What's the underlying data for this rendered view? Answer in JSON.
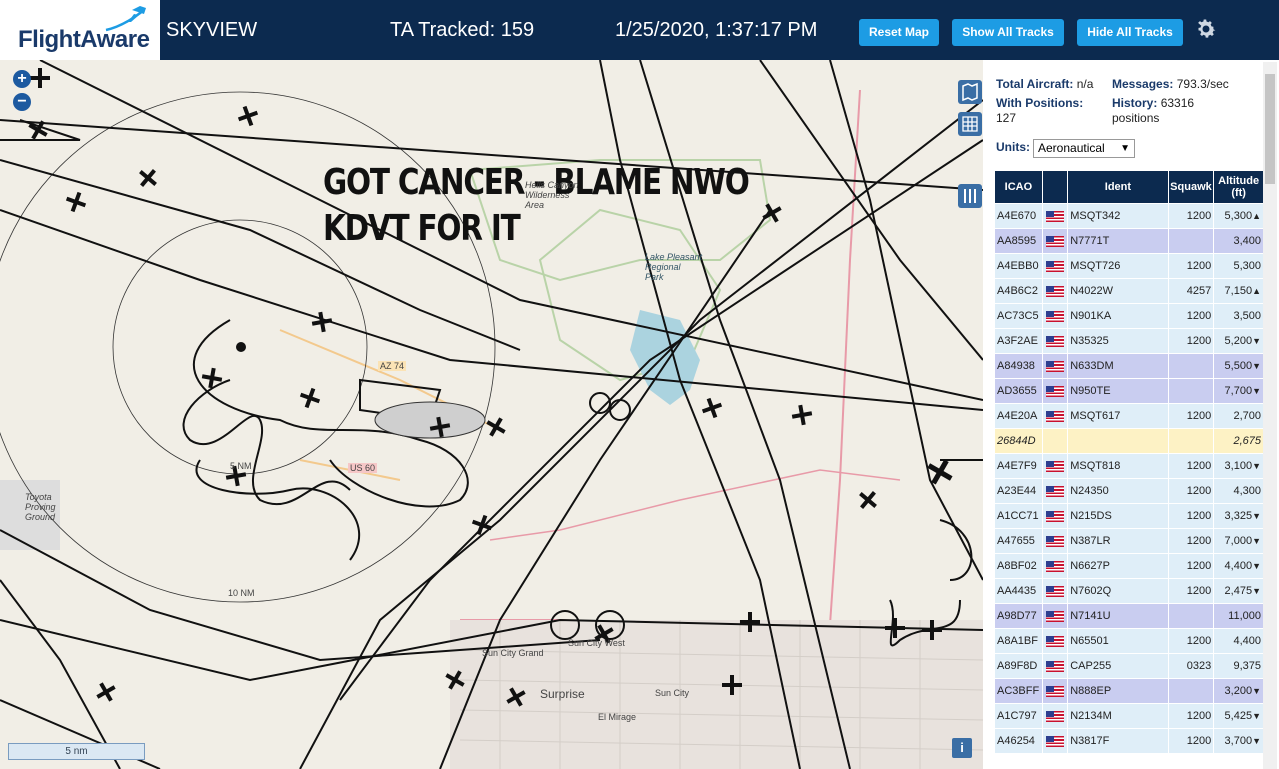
{
  "header": {
    "logo_text": "FlightAware",
    "app_title": "SKYVIEW",
    "ta_tracked": "TA Tracked: 159",
    "datetime": "1/25/2020, 1:37:17 PM",
    "reset_map_label": "Reset Map",
    "show_all_label": "Show All Tracks",
    "hide_all_label": "Hide All Tracks"
  },
  "map": {
    "overlay_line1": "GOT CANCER - BLAME NWO",
    "overlay_line2": "KDVT FOR IT",
    "zoom_in": "+",
    "zoom_out": "−",
    "scale_label": "5 nm",
    "info_label": "i",
    "labels": {
      "hells_canyon": "Hells Canyon\nWilderness\nArea",
      "lake_pleasant": "Lake Pleasant\nRegional\nPark",
      "az74": "AZ 74",
      "us60": "US 60",
      "ring_5": "5 NM",
      "ring_10": "10 NM",
      "sun_city_grand": "Sun City Grand",
      "sun_city_west": "Sun City West",
      "surprise": "Surprise",
      "sun_city": "Sun City",
      "el_mirage": "El Mirage",
      "toyota": "Toyota\nProving\nGround"
    }
  },
  "sidebar": {
    "total_aircraft_label": "Total Aircraft:",
    "total_aircraft_value": "n/a",
    "messages_label": "Messages:",
    "messages_value": "793.3/sec",
    "with_positions_label": "With Positions:",
    "with_positions_value": "127",
    "history_label": "History:",
    "history_value": "63316",
    "history_unit": "positions",
    "units_label": "Units:",
    "units_value": "Aeronautical",
    "columns": {
      "icao": "ICAO",
      "ident": "Ident",
      "squawk": "Squawk",
      "altitude": "Altitude",
      "altitude_unit": "(ft)"
    },
    "rows": [
      {
        "icao": "A4E670",
        "ident": "MSQT342",
        "squawk": "1200",
        "alt": "5,300",
        "trend": "▲",
        "style": "r0",
        "flag": true
      },
      {
        "icao": "AA8595",
        "ident": "N7771T",
        "squawk": "",
        "alt": "3,400",
        "trend": "",
        "style": "r1",
        "flag": true
      },
      {
        "icao": "A4EBB0",
        "ident": "MSQT726",
        "squawk": "1200",
        "alt": "5,300",
        "trend": "",
        "style": "r0",
        "flag": true
      },
      {
        "icao": "A4B6C2",
        "ident": "N4022W",
        "squawk": "4257",
        "alt": "7,150",
        "trend": "▲",
        "style": "r0",
        "flag": true
      },
      {
        "icao": "AC73C5",
        "ident": "N901KA",
        "squawk": "1200",
        "alt": "3,500",
        "trend": "",
        "style": "r0",
        "flag": true
      },
      {
        "icao": "A3F2AE",
        "ident": "N35325",
        "squawk": "1200",
        "alt": "5,200",
        "trend": "▼",
        "style": "r0",
        "flag": true
      },
      {
        "icao": "A84938",
        "ident": "N633DM",
        "squawk": "",
        "alt": "5,500",
        "trend": "▼",
        "style": "r1",
        "flag": true
      },
      {
        "icao": "AD3655",
        "ident": "N950TE",
        "squawk": "",
        "alt": "7,700",
        "trend": "▼",
        "style": "r1",
        "flag": true
      },
      {
        "icao": "A4E20A",
        "ident": "MSQT617",
        "squawk": "1200",
        "alt": "2,700",
        "trend": "",
        "style": "r0",
        "flag": true
      },
      {
        "icao": "26844D",
        "ident": "",
        "squawk": "",
        "alt": "2,675",
        "trend": "",
        "style": "r2",
        "flag": false
      },
      {
        "icao": "A4E7F9",
        "ident": "MSQT818",
        "squawk": "1200",
        "alt": "3,100",
        "trend": "▼",
        "style": "r0",
        "flag": true
      },
      {
        "icao": "A23E44",
        "ident": "N24350",
        "squawk": "1200",
        "alt": "4,300",
        "trend": "",
        "style": "r0",
        "flag": true
      },
      {
        "icao": "A1CC71",
        "ident": "N215DS",
        "squawk": "1200",
        "alt": "3,325",
        "trend": "▼",
        "style": "r0",
        "flag": true
      },
      {
        "icao": "A47655",
        "ident": "N387LR",
        "squawk": "1200",
        "alt": "7,000",
        "trend": "▼",
        "style": "r0",
        "flag": true
      },
      {
        "icao": "A8BF02",
        "ident": "N6627P",
        "squawk": "1200",
        "alt": "4,400",
        "trend": "▼",
        "style": "r0",
        "flag": true
      },
      {
        "icao": "AA4435",
        "ident": "N7602Q",
        "squawk": "1200",
        "alt": "2,475",
        "trend": "▼",
        "style": "r0",
        "flag": true
      },
      {
        "icao": "A98D77",
        "ident": "N7141U",
        "squawk": "",
        "alt": "11,000",
        "trend": "",
        "style": "r1",
        "flag": true
      },
      {
        "icao": "A8A1BF",
        "ident": "N65501",
        "squawk": "1200",
        "alt": "4,400",
        "trend": "",
        "style": "r0",
        "flag": true
      },
      {
        "icao": "A89F8D",
        "ident": "CAP255",
        "squawk": "0323",
        "alt": "9,375",
        "trend": "",
        "style": "r0",
        "flag": true
      },
      {
        "icao": "AC3BFF",
        "ident": "N888EP",
        "squawk": "",
        "alt": "3,200",
        "trend": "▼",
        "style": "r1",
        "flag": true
      },
      {
        "icao": "A1C797",
        "ident": "N2134M",
        "squawk": "1200",
        "alt": "5,425",
        "trend": "▼",
        "style": "r0",
        "flag": true
      },
      {
        "icao": "A46254",
        "ident": "N3817F",
        "squawk": "1200",
        "alt": "3,700",
        "trend": "▼",
        "style": "r0",
        "flag": true
      }
    ]
  }
}
